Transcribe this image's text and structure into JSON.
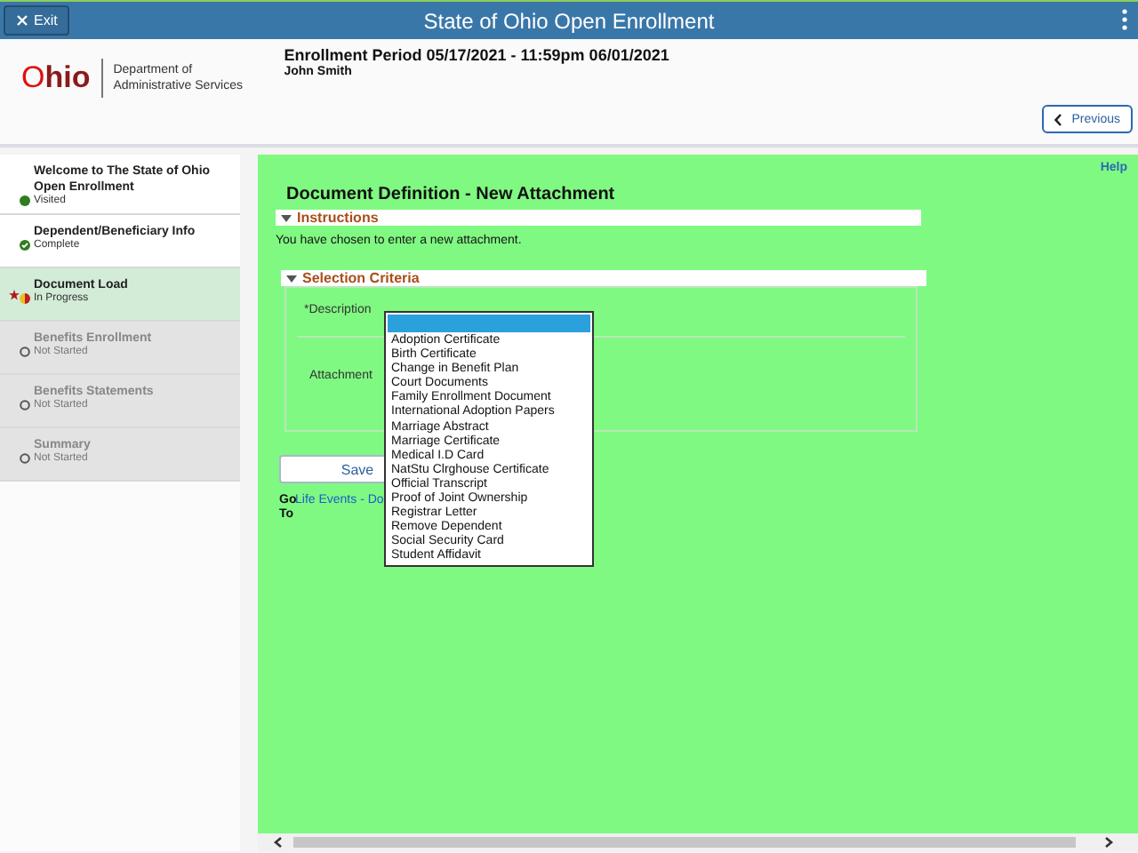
{
  "top_bar": {
    "exit_button": "Exit",
    "title": "State of Ohio Open Enrollment"
  },
  "header": {
    "logo_text": "Ohio",
    "department": "Department of Administrative Services",
    "enrollment_period": "Enrollment Period 05/17/2021 - 11:59pm 06/01/2021",
    "user_name": "John Smith",
    "previous_button": "Previous"
  },
  "steps": [
    {
      "title": "Welcome to The State of Ohio Open Enrollment",
      "status": "Visited",
      "kind": "visited",
      "selected": false
    },
    {
      "title": "Dependent/Beneficiary Info",
      "status": "Complete",
      "kind": "complete",
      "selected": false
    },
    {
      "title": "Document Load",
      "status": "In Progress",
      "kind": "in_progress",
      "selected": true
    },
    {
      "title": "Benefits Enrollment",
      "status": "Not Started",
      "kind": "not_started",
      "selected": false
    },
    {
      "title": "Benefits Statements",
      "status": "Not Started",
      "kind": "not_started",
      "selected": false
    },
    {
      "title": "Summary",
      "status": "Not Started",
      "kind": "not_started",
      "selected": false
    }
  ],
  "main": {
    "help_link": "Help",
    "page_title": "Document Definition - New Attachment",
    "instructions": {
      "heading": "Instructions",
      "expanded": true,
      "text": "You have chosen to enter a new attachment."
    },
    "selection_criteria": {
      "heading": "Selection Criteria",
      "expanded": true,
      "description_label": "*Description",
      "attachment_label": "Attachment"
    },
    "description_dropdown": {
      "open": true,
      "options": [
        "Adoption Certificate",
        "Birth Certificate",
        "Change in Benefit Plan",
        "Court Documents",
        "Family Enrollment Document",
        "International Adoption Papers",
        "Marriage Abstract",
        "Marriage Certificate",
        "Medical I.D Card",
        "NatStu Clrghouse Certificate",
        "Official Transcript",
        "Proof of Joint Ownership",
        "Registrar Letter",
        "Remove Dependent",
        "Social Security Card",
        "Student Affidavit"
      ]
    },
    "save_button": "Save",
    "go_to_label": "Go To",
    "go_to_link": "Life Events - Do"
  }
}
